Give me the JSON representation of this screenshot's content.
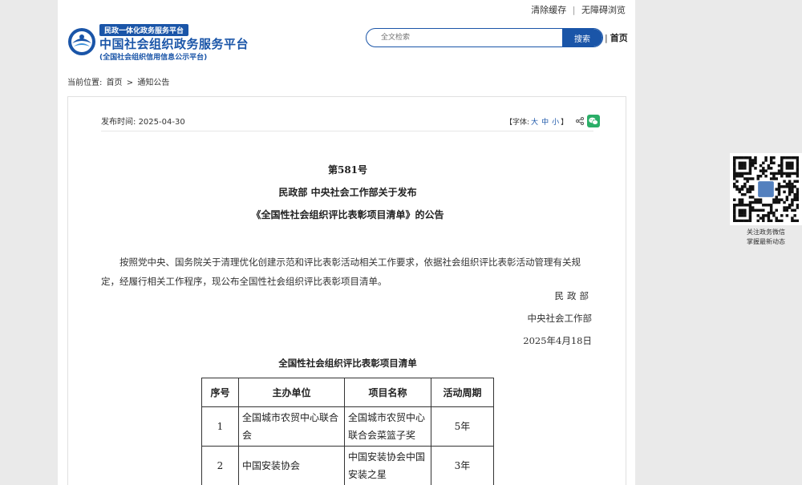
{
  "top_links": {
    "clear_cache": "清除缓存",
    "separator": "|",
    "accessibility": "无障碍浏览"
  },
  "logo": {
    "tag": "民政一体化政务服务平台",
    "title": "中国社会组织政务服务平台",
    "subtitle": "(全国社会组织信用信息公示平台)"
  },
  "search": {
    "placeholder": "全文检索",
    "button": "搜索"
  },
  "nav": {
    "separator": "|",
    "home": "首页"
  },
  "breadcrumb": {
    "label": "当前位置:",
    "home": "首页",
    "arrow": ">",
    "current": "通知公告"
  },
  "article": {
    "meta": {
      "label": "发布时间:",
      "date": "2025-04-30"
    },
    "font_tools": {
      "open": "【字体:",
      "large": "大",
      "medium": "中",
      "small": "小",
      "close": "】"
    },
    "number": "第581号",
    "title_line1": "民政部  中央社会工作部关于发布",
    "title_line2": "《全国性社会组织评比表彰项目清单》的公告",
    "body": "按照党中央、国务院关于清理优化创建示范和评比表彰活动相关工作要求，依据社会组织评比表彰活动管理有关规定，经履行相关工作程序，现公布全国性社会组织评比表彰项目清单。",
    "signature1": "民政部",
    "signature2": "中央社会工作部",
    "sign_date": "2025年4月18日",
    "table_title": "全国性社会组织评比表彰项目清单",
    "table": {
      "headers": [
        "序号",
        "主办单位",
        "项目名称",
        "活动周期"
      ],
      "rows": [
        [
          "1",
          "全国城市农贸中心联合会",
          "全国城市农贸中心联合会菜篮子奖",
          "5年"
        ],
        [
          "2",
          "中国安装协会",
          "中国安装协会中国安装之星",
          "3年"
        ]
      ]
    }
  },
  "qr": {
    "caption_line1": "关注政务微信",
    "caption_line2": "掌握最新动态"
  },
  "colors": {
    "brand": "#1a55a8",
    "page_bg": "#eaeaea",
    "wechat": "#2aae67"
  }
}
